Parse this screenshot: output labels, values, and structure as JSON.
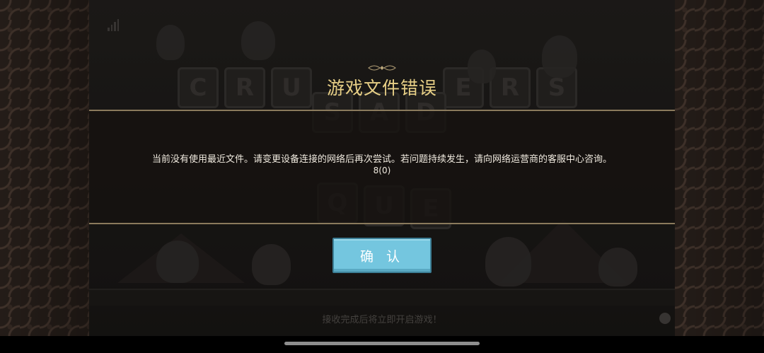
{
  "dialog": {
    "title": "游戏文件错误",
    "message": "当前没有使用最近文件。请变更设备连接的网络后再次尝试。若问题持续发生，请向网络运营商的客服中心咨询。",
    "code": "8(0)",
    "confirm_label": "确 认"
  },
  "background": {
    "logo_row1": [
      "C",
      "R",
      "U",
      "",
      "E",
      "R",
      "S"
    ],
    "logo_row2": [
      "S",
      "A",
      "D"
    ],
    "logo_row3": [
      "Q",
      "U",
      "E"
    ],
    "loading_text": "接收完成后将立即开启游戏！"
  },
  "icons": {
    "signal": "signal-icon",
    "skull": "skull-icon",
    "ornament": "title-ornament-icon"
  },
  "colors": {
    "title": "#e7cf86",
    "button": "#74c6df",
    "divider": "#8a7a5c"
  }
}
